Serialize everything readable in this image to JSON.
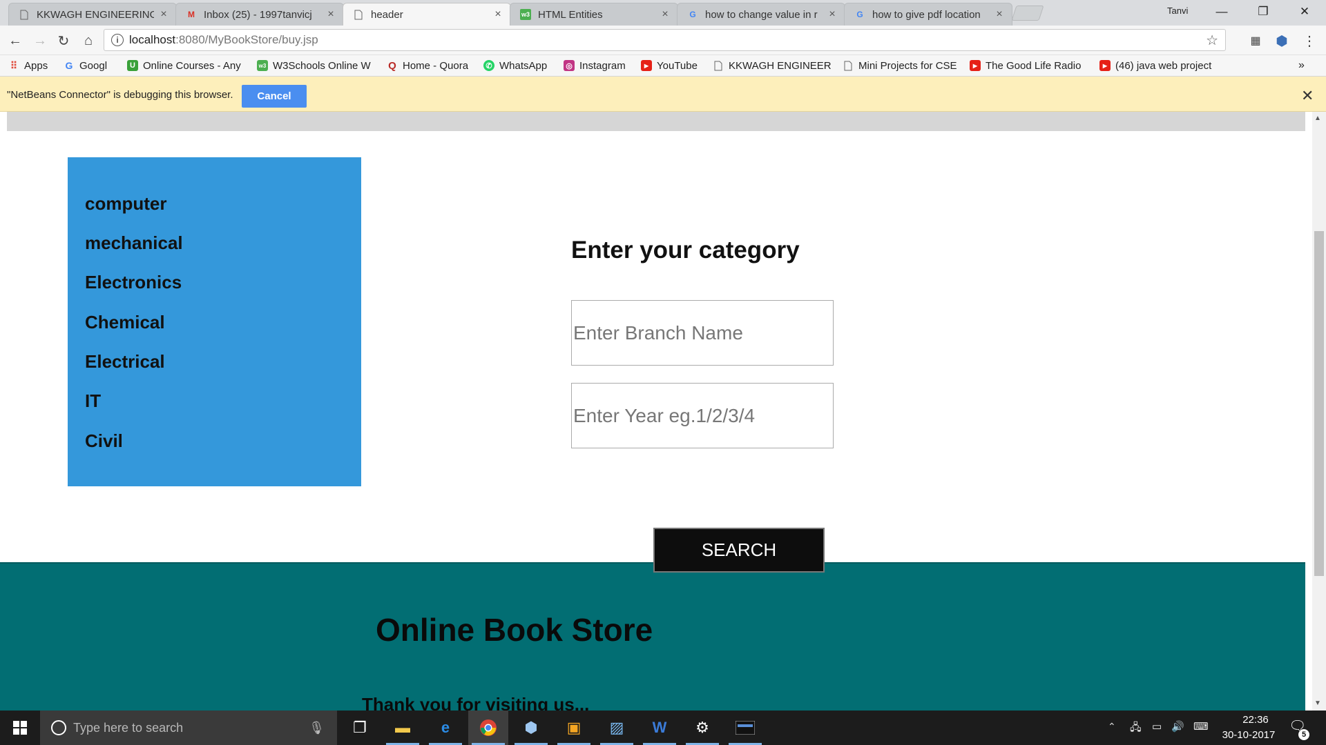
{
  "browser": {
    "tabs": [
      {
        "title": "KKWAGH ENGINEERING",
        "favicon": "page-icon"
      },
      {
        "title": "Inbox (25) - 1997tanvicj",
        "favicon": "gmail-icon"
      },
      {
        "title": "header",
        "favicon": "page-icon",
        "active": true
      },
      {
        "title": "HTML Entities",
        "favicon": "w3schools-icon"
      },
      {
        "title": "how to change value in r",
        "favicon": "google-icon"
      },
      {
        "title": "how to give pdf location",
        "favicon": "google-icon"
      }
    ],
    "profile_name": "Tanvi",
    "url_host": "localhost",
    "url_path": ":8080/MyBookStore/buy.jsp",
    "bookmarks": [
      {
        "label": "Apps",
        "icon": "apps-grid-icon",
        "color": "#e04a3b"
      },
      {
        "label": "Googl",
        "icon": "google-icon",
        "color": "#4285f4"
      },
      {
        "label": "Online Courses - Any",
        "icon": "udemy-icon",
        "color": "#3aa13a"
      },
      {
        "label": "W3Schools Online W",
        "icon": "w3schools-icon",
        "color": "#4caf50"
      },
      {
        "label": "Home - Quora",
        "icon": "quora-icon",
        "color": "#b92b27"
      },
      {
        "label": "WhatsApp",
        "icon": "whatsapp-icon",
        "color": "#25d366"
      },
      {
        "label": "Instagram",
        "icon": "instagram-icon",
        "color": "#c13584"
      },
      {
        "label": "YouTube",
        "icon": "youtube-icon",
        "color": "#e62117"
      },
      {
        "label": "KKWAGH ENGINEERI",
        "icon": "page-icon",
        "color": "#888888"
      },
      {
        "label": "Mini Projects for CSE",
        "icon": "page-icon",
        "color": "#888888"
      },
      {
        "label": "The Good Life Radio",
        "icon": "youtube-icon",
        "color": "#e62117"
      },
      {
        "label": "(46) java web project",
        "icon": "youtube-icon",
        "color": "#e62117"
      }
    ],
    "bookmarks_overflow": "»"
  },
  "infobar": {
    "message": "\"NetBeans Connector\" is debugging this browser.",
    "cancel_label": "Cancel"
  },
  "page": {
    "categories": [
      "computer",
      "mechanical",
      "Electronics",
      "Chemical",
      "Electrical",
      "IT",
      "Civil"
    ],
    "form_heading": "Enter your category",
    "branch_placeholder": "Enter Branch Name",
    "year_placeholder": "Enter Year eg.1/2/3/4",
    "search_label": "SEARCH",
    "footer_title": "Online Book Store",
    "footer_thanks": "Thank you for visiting us..."
  },
  "taskbar": {
    "search_placeholder": "Type here to search",
    "apps": [
      "task-view-icon",
      "file-explorer-icon",
      "edge-icon",
      "chrome-icon",
      "box-app-icon",
      "store-app-icon",
      "photos-icon",
      "word-icon",
      "settings-gear-icon",
      "mysql-icon"
    ],
    "time": "22:36",
    "date": "30-10-2017",
    "notification_count": "5"
  },
  "colors": {
    "sidebar": "#3498db",
    "footer": "#026e73",
    "infobar": "#fdefbb",
    "cancel_button": "#4a8ef0"
  }
}
